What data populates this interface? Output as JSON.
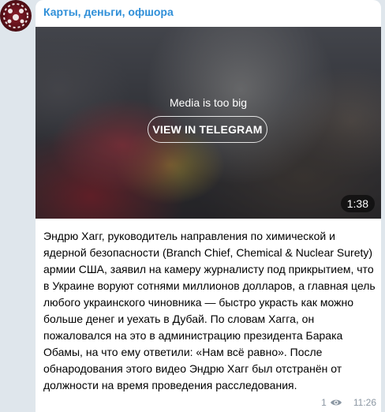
{
  "channel": {
    "name": "Карты, деньги, офшора"
  },
  "media": {
    "message": "Media is too big",
    "button_label": "VIEW IN TELEGRAM",
    "duration": "1:38"
  },
  "post": {
    "text": "Эндрю Хагг, руководитель направления по химической и ядерной безопасности (Branch Chief, Chemical & Nuclear Surety) армии США, заявил на камеру журналисту под прикрытием, что в Украине воруют сотнями миллионов долларов, а главная цель любого украинского чиновника — быстро украсть как можно больше денег и уехать в Дубай. По словам Хагга, он пожаловался на это в администрацию президента Барака Обамы, на что ему ответили: «Нам всё равно». После обнародования этого видео Эндрю Хагг был отстранён от должности на время проведения расследования.",
    "views": "1",
    "time": "11:26",
    "views_icon": "eye-icon"
  },
  "colors": {
    "accent": "#2f8fd8",
    "background": "#dfe6ec",
    "bubble": "#ffffff",
    "meta": "#8b97a3"
  }
}
